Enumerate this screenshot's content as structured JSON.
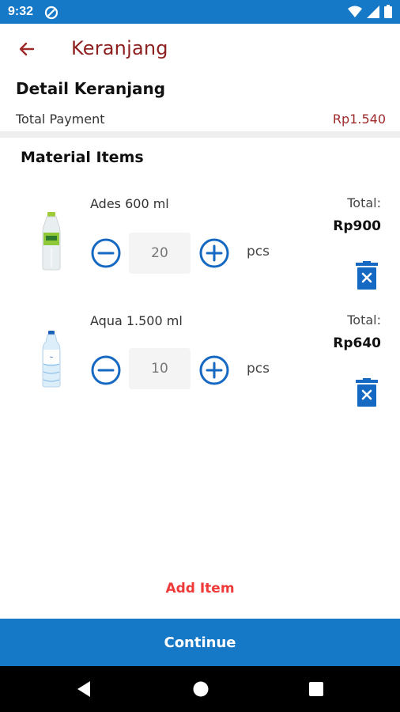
{
  "status_bar": {
    "time": "9:32",
    "app_icon": "circle-slash-icon",
    "icons": [
      "wifi-icon",
      "signal-icon",
      "battery-icon"
    ]
  },
  "app_bar": {
    "title": "Keranjang",
    "back_icon": "arrow-left-icon"
  },
  "detail": {
    "title": "Detail Keranjang",
    "total_label": "Total Payment",
    "total_value": "Rp1.540"
  },
  "materials": {
    "section_title": "Material Items",
    "items": [
      {
        "name": "Ades 600 ml",
        "quantity": "20",
        "unit": "pcs",
        "total_label": "Total:",
        "total_value": "Rp900",
        "image": "ades-bottle-image"
      },
      {
        "name": "Aqua 1.500 ml",
        "quantity": "10",
        "unit": "pcs",
        "total_label": "Total:",
        "total_value": "Rp640",
        "image": "aqua-bottle-image"
      }
    ]
  },
  "actions": {
    "add_item": "Add Item",
    "continue": "Continue"
  },
  "colors": {
    "primary": "#1679c7",
    "title_red": "#8e1f1f",
    "accent_red": "#f03a3a"
  }
}
